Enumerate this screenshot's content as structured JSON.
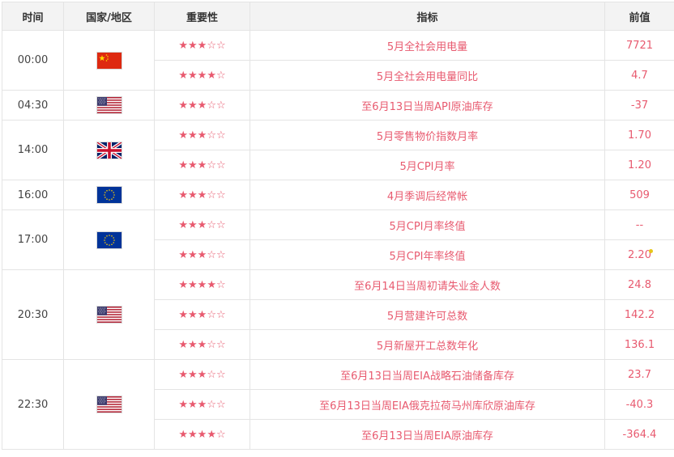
{
  "headers": {
    "time": "时间",
    "country": "国家/地区",
    "importance": "重要性",
    "indicator": "指标",
    "previous": "前值"
  },
  "groups": [
    {
      "time": "00:00",
      "flag": "cn-flag-icon",
      "rows": [
        {
          "stars": "★★★☆☆",
          "indicator": "5月全社会用电量",
          "previous": "7721"
        },
        {
          "stars": "★★★★☆",
          "indicator": "5月全社会用电量同比",
          "previous": "4.7"
        }
      ]
    },
    {
      "time": "04:30",
      "flag": "us-flag-icon",
      "rows": [
        {
          "stars": "★★★☆☆",
          "indicator": "至6月13日当周API原油库存",
          "previous": "-37"
        }
      ]
    },
    {
      "time": "14:00",
      "flag": "uk-flag-icon",
      "rows": [
        {
          "stars": "★★★☆☆",
          "indicator": "5月零售物价指数月率",
          "previous": "1.70"
        },
        {
          "stars": "★★★☆☆",
          "indicator": "5月CPI月率",
          "previous": "1.20"
        }
      ]
    },
    {
      "time": "16:00",
      "flag": "eu-flag-icon",
      "rows": [
        {
          "stars": "★★★☆☆",
          "indicator": "4月季调后经常帐",
          "previous": "509"
        }
      ]
    },
    {
      "time": "17:00",
      "flag": "eu-flag-icon",
      "rows": [
        {
          "stars": "★★★☆☆",
          "indicator": "5月CPI月率终值",
          "previous": "--"
        },
        {
          "stars": "★★★☆☆",
          "indicator": "5月CPI年率终值",
          "previous": "2.20"
        }
      ]
    },
    {
      "time": "20:30",
      "flag": "us-flag-icon",
      "rows": [
        {
          "stars": "★★★★☆",
          "indicator": "至6月14日当周初请失业金人数",
          "previous": "24.8"
        },
        {
          "stars": "★★★☆☆",
          "indicator": "5月营建许可总数",
          "previous": "142.2"
        },
        {
          "stars": "★★★☆☆",
          "indicator": "5月新屋开工总数年化",
          "previous": "136.1"
        }
      ]
    },
    {
      "time": "22:30",
      "flag": "us-flag-icon",
      "rows": [
        {
          "stars": "★★★☆☆",
          "indicator": "至6月13日当周EIA战略石油储备库存",
          "previous": "23.7"
        },
        {
          "stars": "★★★☆☆",
          "indicator": "至6月13日当周EIA俄克拉荷马州库欣原油库存",
          "previous": "-40.3"
        },
        {
          "stars": "★★★★☆",
          "indicator": "至6月13日当周EIA原油库存",
          "previous": "-364.4"
        }
      ]
    }
  ],
  "colors": {
    "accent": "#e85a6f",
    "header_bg": "#f3f3f3",
    "border": "#e4e4e4",
    "dot": "#e6c619"
  }
}
